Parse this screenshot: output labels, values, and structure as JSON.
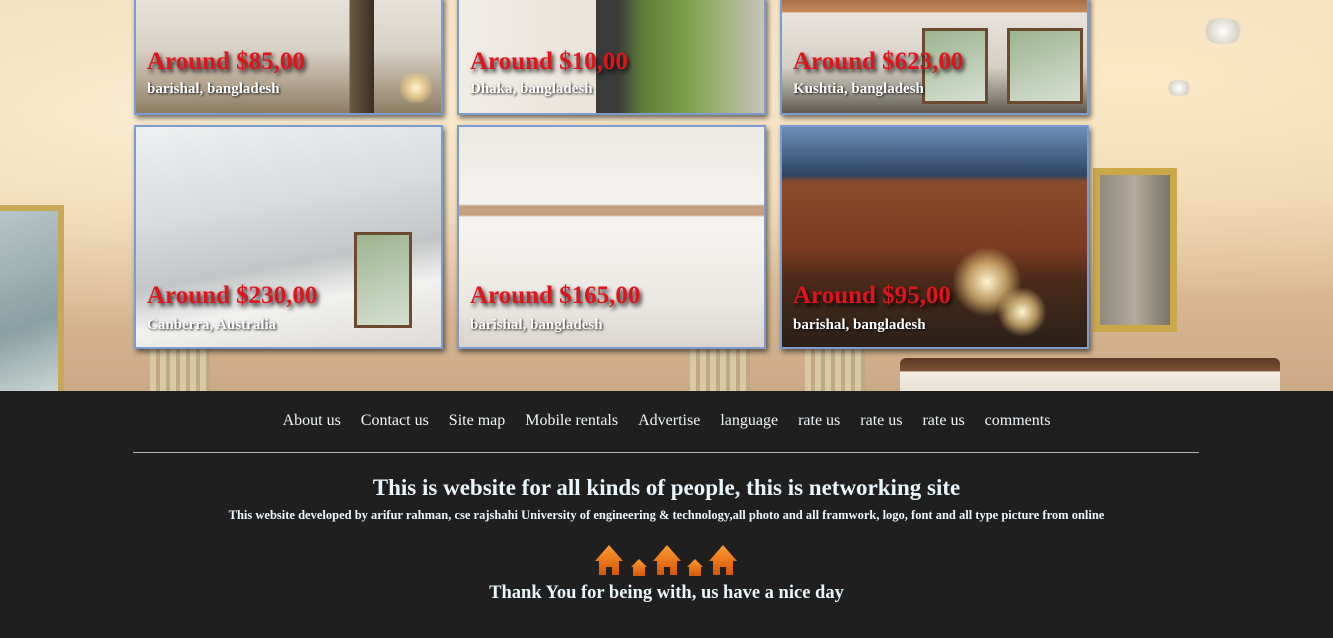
{
  "listings": [
    {
      "price": "Around $85,00",
      "location": "barishal, bangladesh"
    },
    {
      "price": "Around $10,00",
      "location": "Dhaka, bangladesh"
    },
    {
      "price": "Around $623,00",
      "location": "Kushtia, bangladesh"
    },
    {
      "price": "Around $230,00",
      "location": "Canberra, Australia"
    },
    {
      "price": "Around $165,00",
      "location": "barishal, bangladesh"
    },
    {
      "price": "Around $95,00",
      "location": "barishal, bangladesh"
    }
  ],
  "footer": {
    "nav": [
      "About us",
      "Contact us",
      "Site map",
      "Mobile rentals",
      "Advertise",
      "language",
      "rate us",
      "rate us",
      "rate us",
      "comments"
    ],
    "heading": "This is website for all kinds of people, this is networking site",
    "credit": "This website developed by arifur rahman, cse rajshahi University of engineering & technology,all photo and all framwork, logo, font and all type picture from online",
    "thanks": "Thank You for being with, us have a nice day",
    "logo_icon": "house-logo-icon",
    "logo_color": "#f07a12"
  },
  "colors": {
    "price": "#e1131b",
    "card_border": "#7b9bd1",
    "footer_bg": "#1f1f1f"
  }
}
